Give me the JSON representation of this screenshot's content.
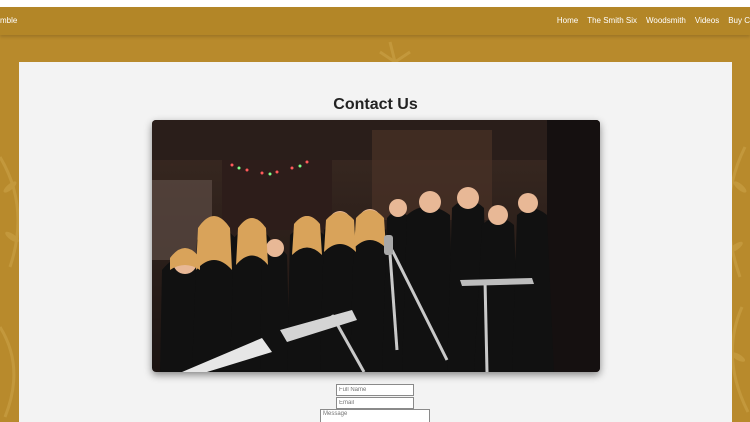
{
  "nav": {
    "brand_fragment": "mble",
    "links": [
      "Home",
      "The Smith Six",
      "Woodsmith",
      "Videos",
      "Buy C"
    ]
  },
  "main": {
    "title": "Contact Us",
    "photo_icon": "group-photo",
    "form": {
      "name_placeholder": "Full Name",
      "email_placeholder": "Email",
      "message_placeholder": "Message"
    }
  },
  "colors": {
    "background_gold": "#b88a2c",
    "nav_gold": "#b38627",
    "panel": "#f3f3f3"
  }
}
